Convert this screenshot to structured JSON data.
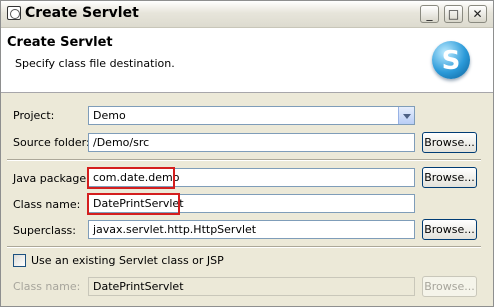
{
  "window": {
    "title": "Create Servlet"
  },
  "header": {
    "title": "Create Servlet",
    "description": "Specify class file destination.",
    "logo_letter": "S"
  },
  "form": {
    "project": {
      "label": "Project:",
      "value": "Demo"
    },
    "source_folder": {
      "label": "Source folder:",
      "value": "/Demo/src",
      "button": "Browse..."
    },
    "java_package": {
      "label": "Java package:",
      "value": "com.date.demo",
      "button": "Browse..."
    },
    "class_name": {
      "label": "Class name:",
      "value": "DatePrintServlet"
    },
    "superclass": {
      "label": "Superclass:",
      "value": "javax.servlet.http.HttpServlet",
      "button": "Browse..."
    },
    "existing_servlet": {
      "label": "Use an existing Servlet class or JSP",
      "checked": false
    },
    "existing_class_name": {
      "label": "Class name:",
      "value": "DatePrintServlet",
      "button": "Browse..."
    }
  },
  "colors": {
    "highlight": "#D41E1E",
    "dialog_bg": "#ECE9D8"
  }
}
